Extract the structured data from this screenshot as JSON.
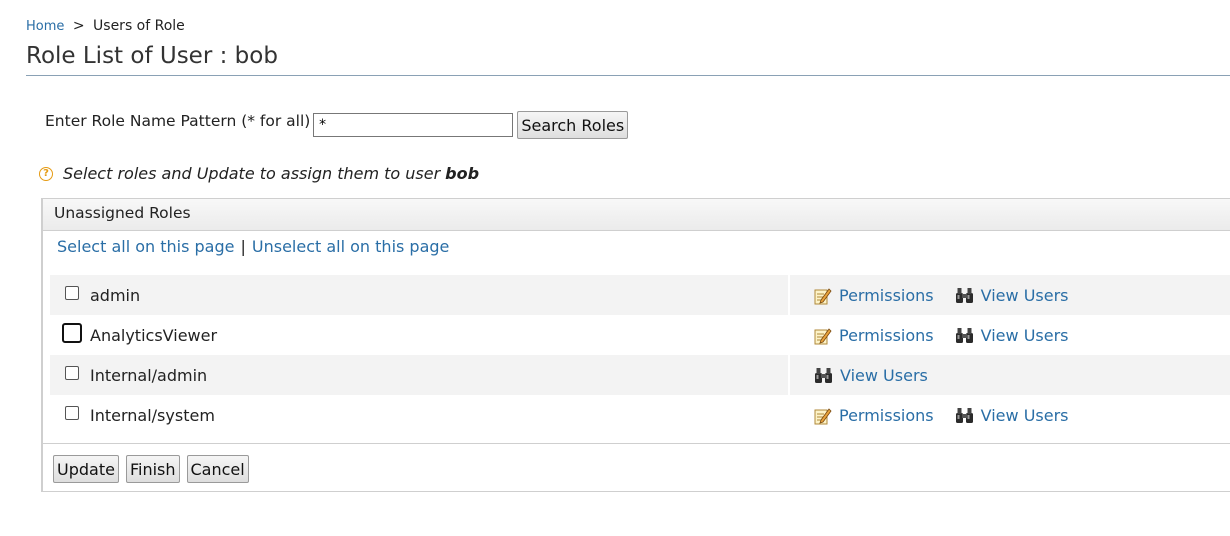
{
  "breadcrumb": {
    "home": "Home",
    "separator": ">",
    "current": "Users of Role"
  },
  "page": {
    "title": "Role List of User : bob"
  },
  "search": {
    "label": "Enter Role Name Pattern (* for all)",
    "value": "*",
    "button_label": "Search Roles"
  },
  "hint": {
    "text": "Select roles and Update to assign them to user",
    "user": "bob"
  },
  "panel": {
    "header": "Unassigned Roles",
    "select_all": "Select all on this page",
    "separator": "|",
    "unselect_all": "Unselect all on this page"
  },
  "roles": [
    {
      "name": "admin",
      "checked": false,
      "permissions_label": "Permissions",
      "view_users_label": "View Users"
    },
    {
      "name": "AnalyticsViewer",
      "checked": true,
      "permissions_label": "Permissions",
      "view_users_label": "View Users"
    },
    {
      "name": "Internal/admin",
      "checked": false,
      "view_users_label": "View Users"
    },
    {
      "name": "Internal/system",
      "checked": false,
      "permissions_label": "Permissions",
      "view_users_label": "View Users"
    }
  ],
  "buttons": {
    "update": "Update",
    "finish": "Finish",
    "cancel": "Cancel"
  },
  "colors": {
    "link": "#2a6ea6",
    "checkbox_checked": "#1d6fe0",
    "help_icon": "#e59b14"
  },
  "icons": {
    "permissions": "edit-note-icon",
    "view_users": "binoculars-icon",
    "help": "question-circle-icon"
  }
}
